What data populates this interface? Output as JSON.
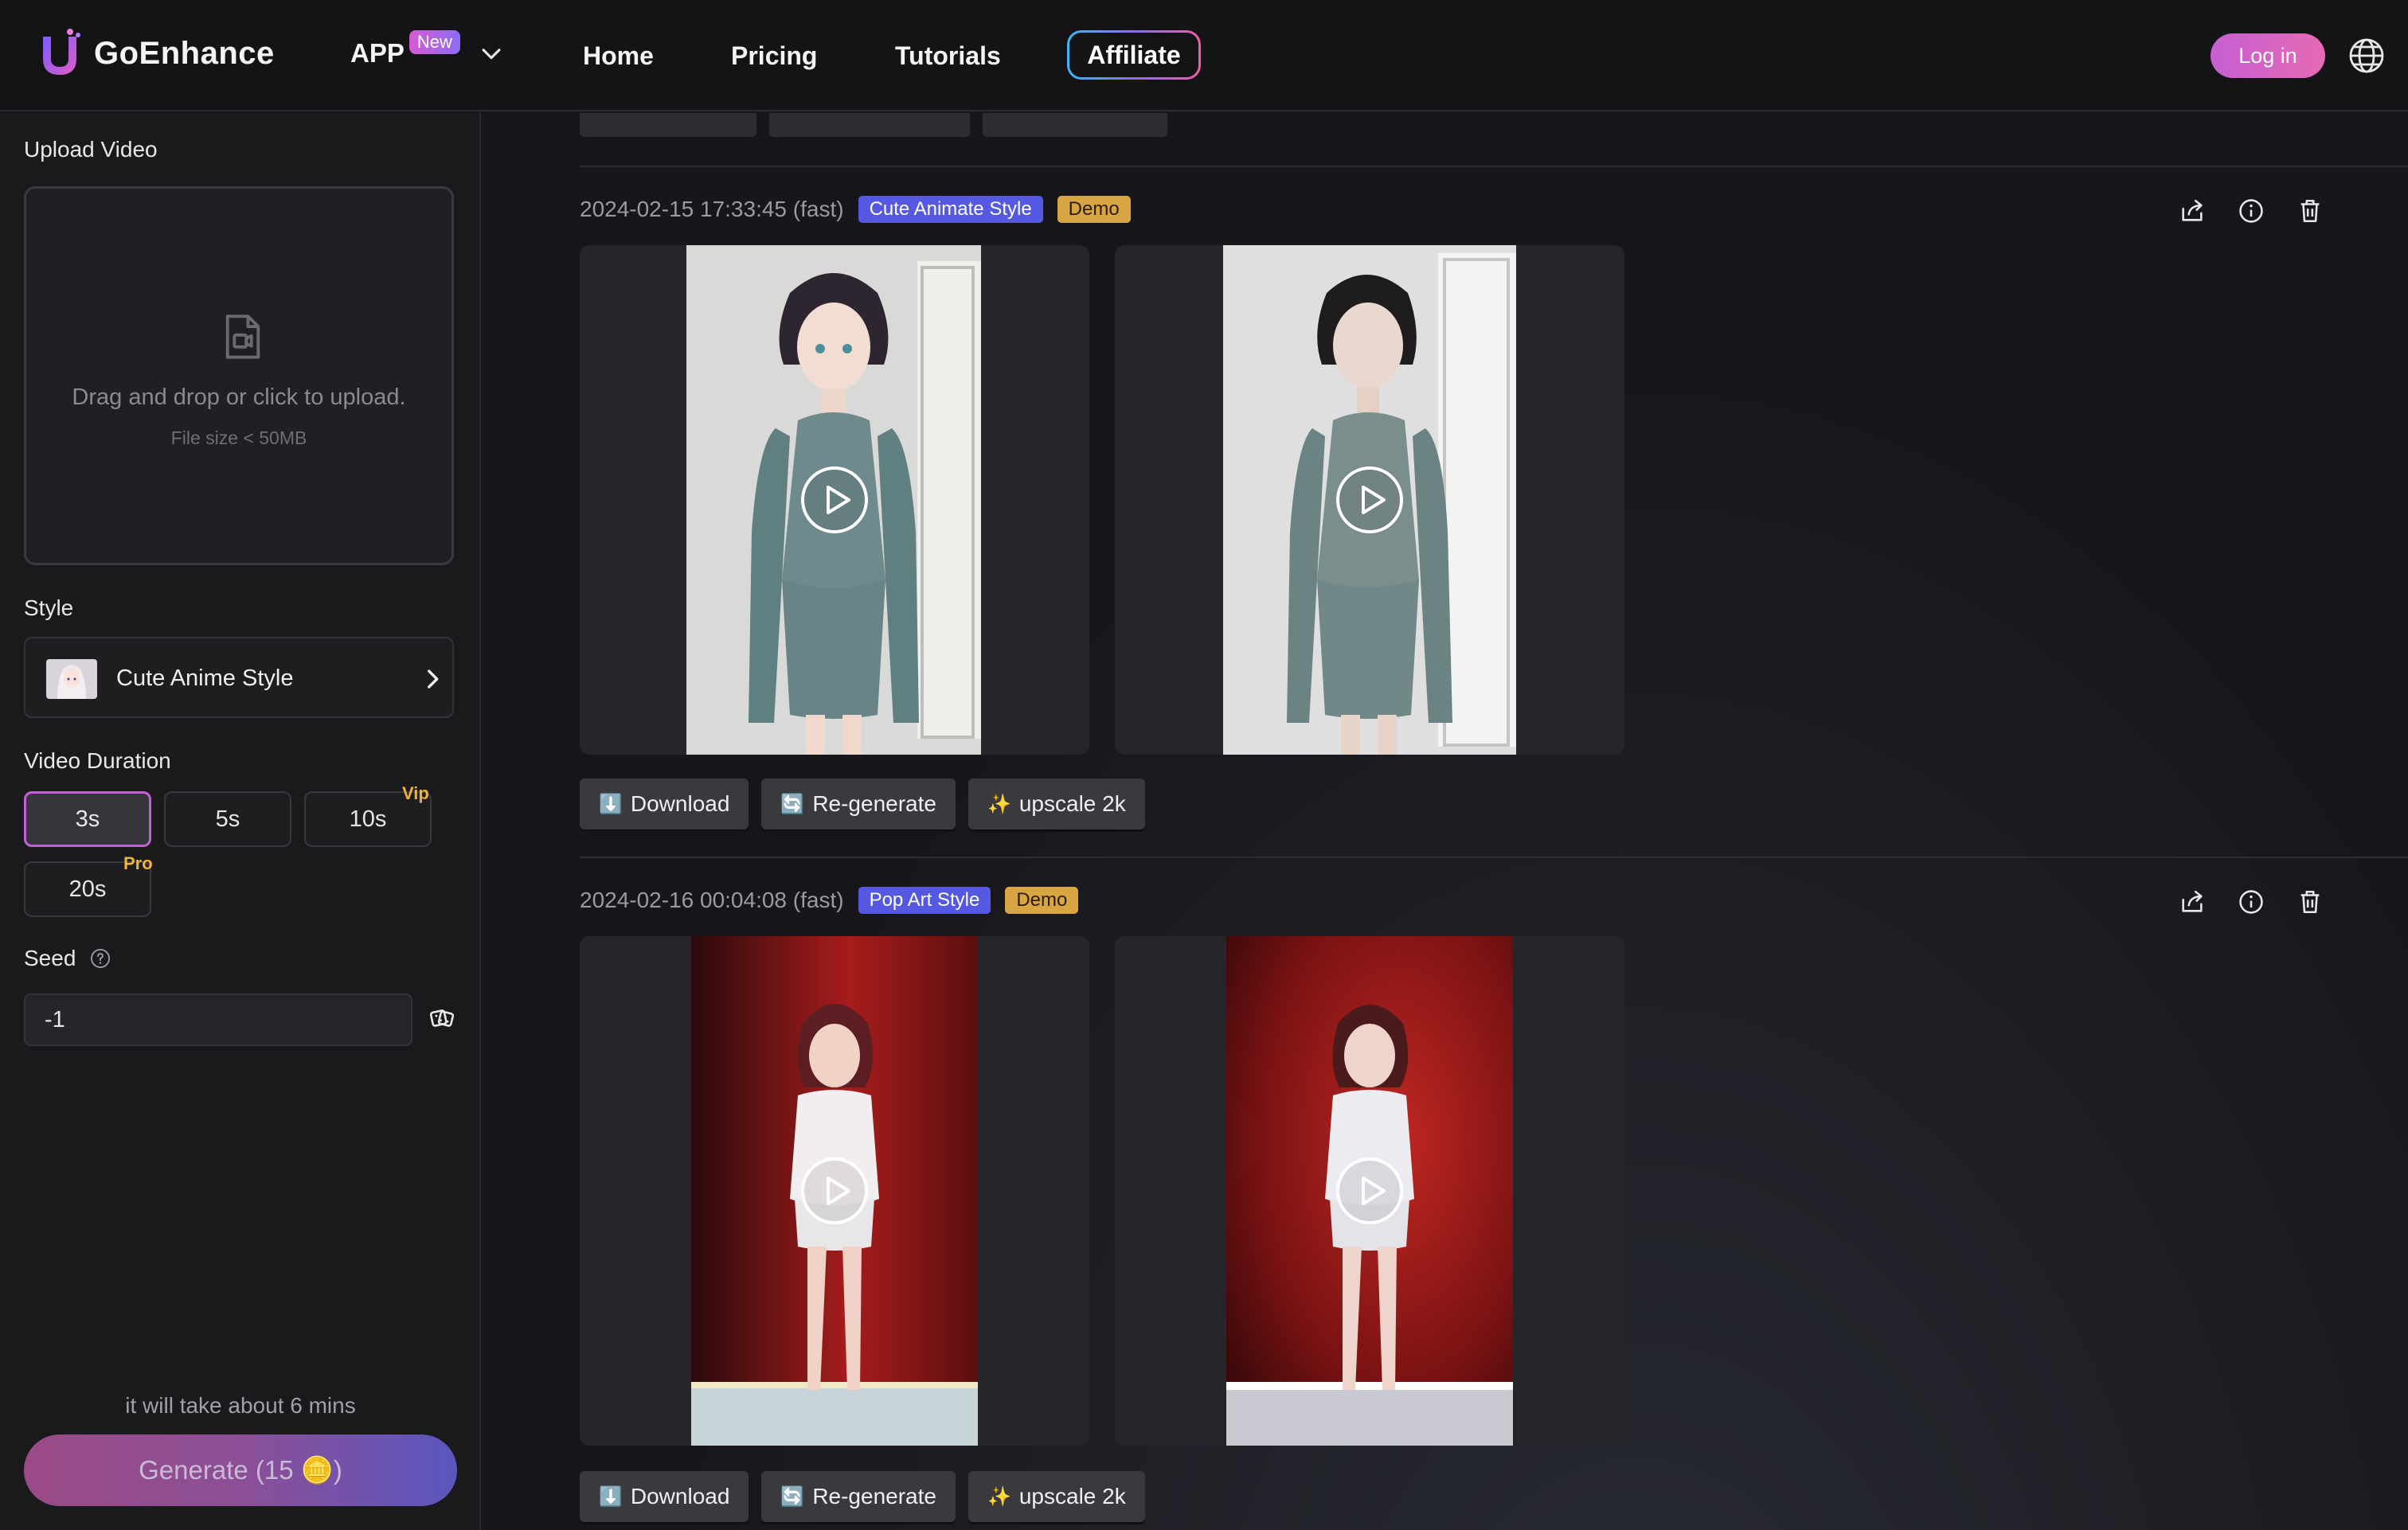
{
  "nav": {
    "brand": "GoEnhance",
    "app_label": "APP",
    "new_badge": "New",
    "links": [
      "Home",
      "Pricing",
      "Tutorials"
    ],
    "affiliate": "Affiliate",
    "login": "Log in"
  },
  "sidebar": {
    "upload_label": "Upload Video",
    "upload_text": "Drag and drop or click to upload.",
    "upload_sub": "File size < 50MB",
    "style_label": "Style",
    "style_value": "Cute Anime Style",
    "duration_label": "Video Duration",
    "durations": [
      "3s",
      "5s",
      "10s",
      "20s"
    ],
    "vip_tag": "Vip",
    "pro_tag": "Pro",
    "seed_label": "Seed",
    "seed_value": "-1",
    "eta": "it will take about 6 mins",
    "generate": "Generate (15 🪙)"
  },
  "results": [
    {
      "timestamp": "2024-02-15 17:33:45 (fast)",
      "style_tag": "Cute Animate Style",
      "demo_tag": "Demo",
      "download": "Download",
      "regenerate": "Re-generate",
      "upscale": "upscale 2k"
    },
    {
      "timestamp": "2024-02-16 00:04:08 (fast)",
      "style_tag": "Pop Art Style",
      "demo_tag": "Demo",
      "download": "Download",
      "regenerate": "Re-generate",
      "upscale": "upscale 2k"
    }
  ],
  "icons": {
    "download_glyph": "⬇️",
    "regenerate_glyph": "🔄",
    "upscale_glyph": "✨"
  }
}
